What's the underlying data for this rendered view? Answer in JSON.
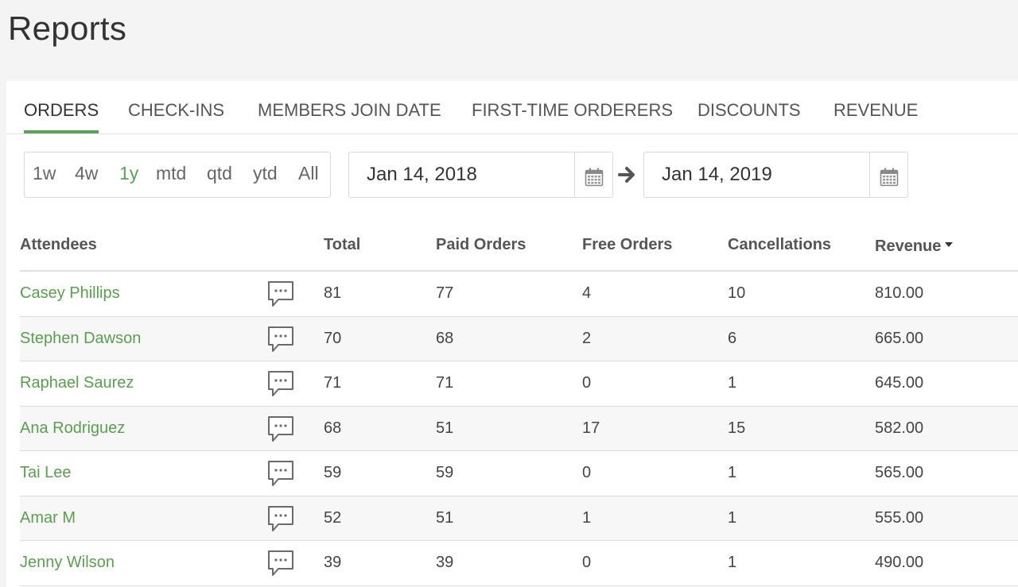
{
  "page": {
    "title": "Reports"
  },
  "tabs": [
    {
      "label": "ORDERS",
      "active": true
    },
    {
      "label": "CHECK-INS",
      "active": false
    },
    {
      "label": "MEMBERS JOIN DATE",
      "active": false
    },
    {
      "label": "FIRST-TIME ORDERERS",
      "active": false
    },
    {
      "label": "DISCOUNTS",
      "active": false
    },
    {
      "label": "REVENUE",
      "active": false
    }
  ],
  "range": {
    "options": [
      "1w",
      "4w",
      "1y",
      "mtd",
      "qtd",
      "ytd",
      "All"
    ],
    "selected": "1y",
    "start_date": "Jan 14, 2018",
    "end_date": "Jan 14, 2019"
  },
  "table": {
    "columns": {
      "attendees": "Attendees",
      "total": "Total",
      "paid": "Paid Orders",
      "free": "Free Orders",
      "cancellations": "Cancellations",
      "revenue": "Revenue"
    },
    "sorted_by": "Revenue",
    "sort_direction": "descending",
    "rows": [
      {
        "name": "Casey Phillips",
        "total": "81",
        "paid": "77",
        "free": "4",
        "cancellations": "10",
        "revenue": "810.00"
      },
      {
        "name": "Stephen Dawson",
        "total": "70",
        "paid": "68",
        "free": "2",
        "cancellations": "6",
        "revenue": "665.00"
      },
      {
        "name": "Raphael Saurez",
        "total": "71",
        "paid": "71",
        "free": "0",
        "cancellations": "1",
        "revenue": "645.00"
      },
      {
        "name": "Ana Rodriguez",
        "total": "68",
        "paid": "51",
        "free": "17",
        "cancellations": "15",
        "revenue": "582.00"
      },
      {
        "name": "Tai Lee",
        "total": "59",
        "paid": "59",
        "free": "0",
        "cancellations": "1",
        "revenue": "565.00"
      },
      {
        "name": "Amar M",
        "total": "52",
        "paid": "51",
        "free": "1",
        "cancellations": "1",
        "revenue": "555.00"
      },
      {
        "name": "Jenny Wilson",
        "total": "39",
        "paid": "39",
        "free": "0",
        "cancellations": "1",
        "revenue": "490.00"
      }
    ]
  },
  "colors": {
    "accent": "#5aa35a",
    "link": "#5a9e4f",
    "background": "#f4f4f4"
  },
  "icons": {
    "message": "speech-bubble-icon",
    "calendar": "calendar-icon",
    "arrow": "arrow-right-icon"
  }
}
